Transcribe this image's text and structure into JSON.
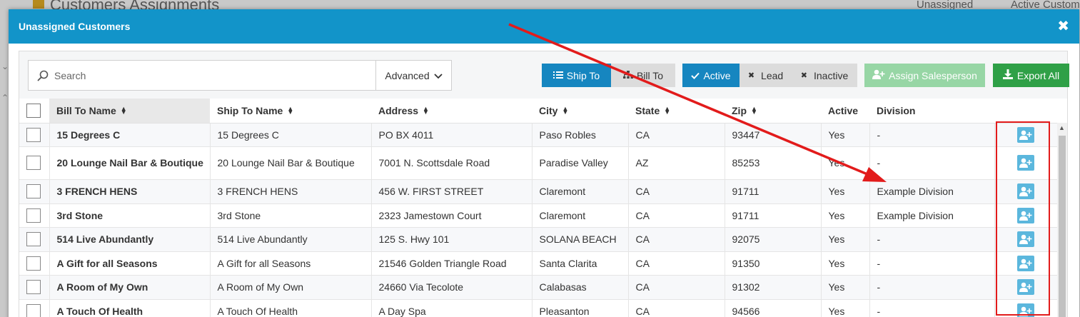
{
  "background": {
    "title": "Customers Assignments",
    "tabs": [
      "Unassigned",
      "Active Custom"
    ]
  },
  "modal": {
    "title": "Unassigned Customers",
    "close_icon": "close-icon"
  },
  "toolbar": {
    "search_placeholder": "Search",
    "advanced_label": "Advanced",
    "ship_to_label": "Ship To",
    "bill_to_label": "Bill To",
    "active_label": "Active",
    "lead_label": "Lead",
    "inactive_label": "Inactive",
    "assign_label": "Assign Salesperson",
    "export_label": "Export All"
  },
  "table": {
    "columns": [
      "Bill To Name",
      "Ship To Name",
      "Address",
      "City",
      "State",
      "Zip",
      "Active",
      "Division"
    ],
    "rows": [
      {
        "bill_to": "15 Degrees C",
        "ship_to": "15 Degrees C",
        "address": "PO BX 4011",
        "city": "Paso Robles",
        "state": "CA",
        "zip": "93447",
        "active": "Yes",
        "division": "-"
      },
      {
        "bill_to": "20 Lounge Nail Bar & Boutique",
        "ship_to": "20 Lounge Nail Bar & Boutique",
        "address": "7001 N. Scottsdale Road",
        "city": "Paradise Valley",
        "state": "AZ",
        "zip": "85253",
        "active": "Yes",
        "division": "-"
      },
      {
        "bill_to": "3 FRENCH HENS",
        "ship_to": "3 FRENCH HENS",
        "address": "456 W. FIRST STREET",
        "city": "Claremont",
        "state": "CA",
        "zip": "91711",
        "active": "Yes",
        "division": "Example Division"
      },
      {
        "bill_to": "3rd Stone",
        "ship_to": "3rd Stone",
        "address": "2323 Jamestown Court",
        "city": "Claremont",
        "state": "CA",
        "zip": "91711",
        "active": "Yes",
        "division": "Example Division"
      },
      {
        "bill_to": "514 Live Abundantly",
        "ship_to": "514 Live Abundantly",
        "address": "125 S. Hwy 101",
        "city": "SOLANA BEACH",
        "state": "CA",
        "zip": "92075",
        "active": "Yes",
        "division": "-"
      },
      {
        "bill_to": "A Gift for all Seasons",
        "ship_to": "A Gift for all Seasons",
        "address": "21546 Golden Triangle Road",
        "city": "Santa Clarita",
        "state": "CA",
        "zip": "91350",
        "active": "Yes",
        "division": "-"
      },
      {
        "bill_to": "A Room of My Own",
        "ship_to": "A Room of My Own",
        "address": "24660 Via Tecolote",
        "city": "Calabasas",
        "state": "CA",
        "zip": "91302",
        "active": "Yes",
        "division": "-"
      },
      {
        "bill_to": "A Touch Of Health",
        "ship_to": "A Touch Of Health",
        "address": "A Day Spa",
        "city": "Pleasanton",
        "state": "CA",
        "zip": "94566",
        "active": "Yes",
        "division": "-"
      }
    ]
  },
  "colors": {
    "header_blue": "#1294c9",
    "primary": "#1686c0",
    "assign_disabled": "#97d6a5",
    "export_green": "#2fa047",
    "row_action": "#5bb7dd",
    "annotation_red": "#e21b1b"
  }
}
